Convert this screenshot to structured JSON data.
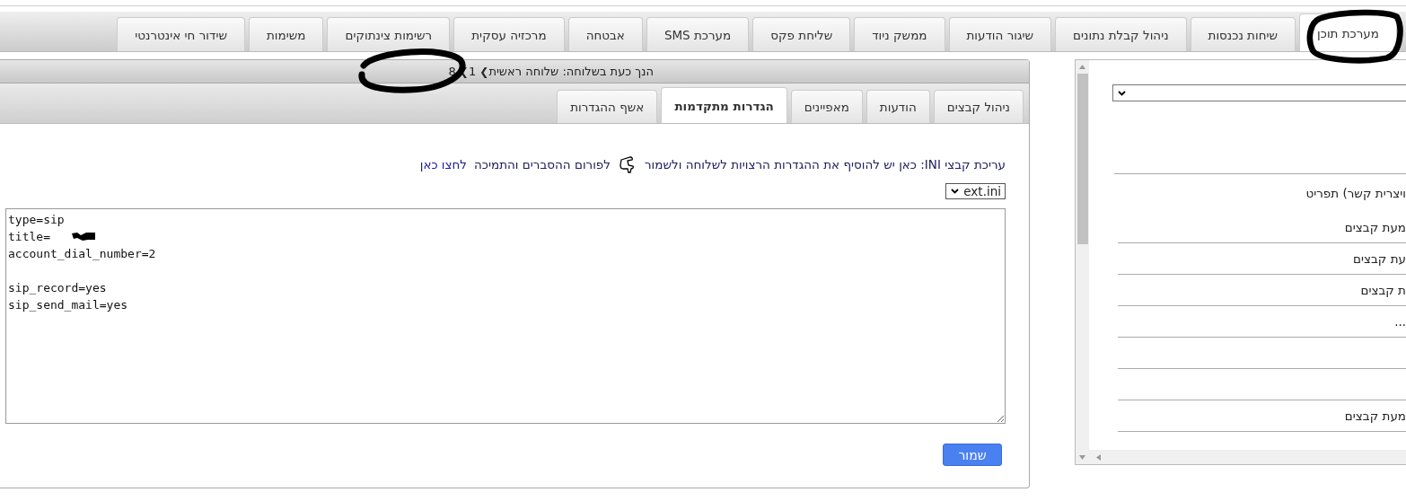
{
  "top_tabs": [
    {
      "label": "מערכת תוכן",
      "selected": true
    },
    {
      "label": "שיחות נכנסות",
      "selected": false
    },
    {
      "label": "ניהול קבלת נתונים",
      "selected": false
    },
    {
      "label": "שיגור הודעות",
      "selected": false
    },
    {
      "label": "ממשק ניוד",
      "selected": false
    },
    {
      "label": "שליחת פקס",
      "selected": false
    },
    {
      "label": "מערכת SMS",
      "selected": false
    },
    {
      "label": "אבטחה",
      "selected": false
    },
    {
      "label": "מרכזיה עסקית",
      "selected": false
    },
    {
      "label": "רשימות צינתוקים",
      "selected": false
    },
    {
      "label": "משימות",
      "selected": false
    },
    {
      "label": "שידור חי אינטרנטי",
      "selected": false
    }
  ],
  "breadcrumb": {
    "prefix": "הנך כעת בשלוחה:",
    "parts": [
      "שלוחה ראשית",
      "1",
      "8"
    ],
    "separator": "❯"
  },
  "sub_tabs": [
    {
      "label": "ניהול קבצים",
      "selected": false
    },
    {
      "label": "הודעות",
      "selected": false
    },
    {
      "label": "מאפיינים",
      "selected": false
    },
    {
      "label": "הגדרות מתקדמות",
      "selected": true
    },
    {
      "label": "אשף ההגדרות",
      "selected": false
    }
  ],
  "info": {
    "text": "עריכת קבצי INI: כאן יש להוסיף את ההגדרות הרצויות לשלוחה ולשמור",
    "forum_text": "לפורום ההסברים והתמיכה",
    "link": "לחצו כאן"
  },
  "file_select": {
    "value": "ext.ini"
  },
  "editor": {
    "value": "type=sip\ntitle=\naccount_dial_number=2\n\nsip_record=yes\nsip_send_mail=yes"
  },
  "save_button": "שמור",
  "side_panel": {
    "items": [
      {
        "label": "ויצרית קשר) תפריט",
        "kind": "plain"
      },
      {
        "label": "מעת קבצים",
        "kind": "line"
      },
      {
        "label": "עת קבצים",
        "kind": "line"
      },
      {
        "label": "ת קבצים",
        "kind": "line"
      },
      {
        "label": "...",
        "kind": "line"
      },
      {
        "kind": "line"
      },
      {
        "kind": "line"
      },
      {
        "label": "מעת קבצים",
        "kind": "line"
      }
    ]
  }
}
